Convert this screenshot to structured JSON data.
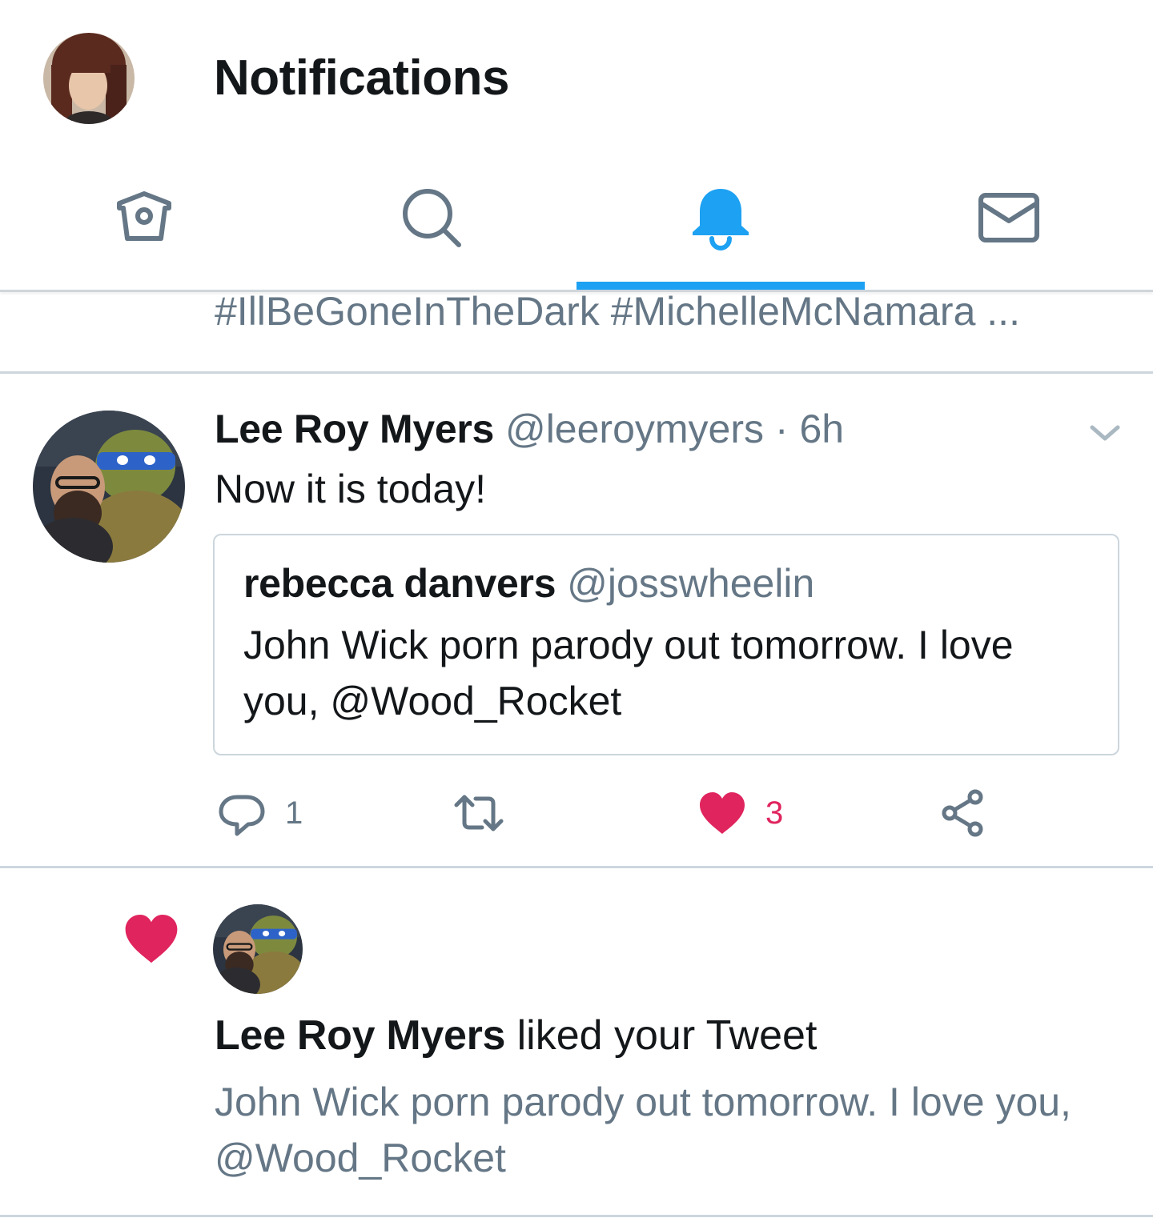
{
  "header": {
    "title": "Notifications"
  },
  "tabs": [
    {
      "icon": "home-icon",
      "active": false
    },
    {
      "icon": "search-icon",
      "active": false
    },
    {
      "icon": "bell-icon",
      "active": true
    },
    {
      "icon": "mail-icon",
      "active": false
    }
  ],
  "colors": {
    "accent": "#1da1f2",
    "like": "#e0245e",
    "secondary_text": "#657786",
    "divider": "#ccd6dd"
  },
  "previous_item": {
    "hashtags": "#IllBeGoneInTheDark #MichelleMcNamara ..."
  },
  "tweet": {
    "author_name": "Lee Roy Myers",
    "author_handle": "@leeroymyers",
    "separator": "·",
    "time": "6h",
    "text": "Now it is today!",
    "quote": {
      "author_name": "rebecca danvers",
      "author_handle": "@josswheelin",
      "text": "John Wick porn parody out tomorrow. I love you, @Wood_Rocket"
    },
    "actions": {
      "reply_count": "1",
      "retweet_count": "",
      "like_count": "3",
      "liked": true
    }
  },
  "like_notification": {
    "actor_name": "Lee Roy Myers",
    "action_text": " liked your Tweet",
    "tweet_text": "John Wick porn parody out tomorrow. I love you, @Wood_Rocket"
  }
}
